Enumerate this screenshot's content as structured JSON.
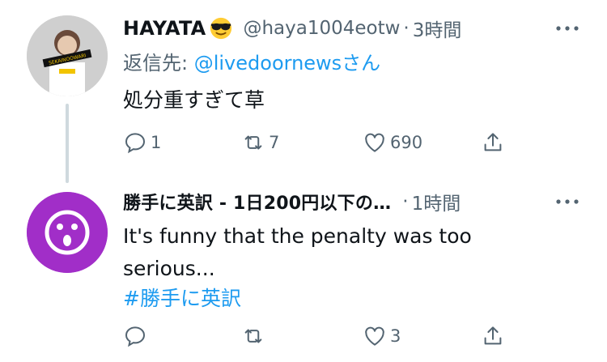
{
  "tweets": [
    {
      "display_name": "HAYATA",
      "handle": "@haya1004eotw",
      "dot": "·",
      "time": "3時間",
      "reply_prefix": "返信先: ",
      "reply_mention": "@livedoornewsさん",
      "text": "処分重すぎて草",
      "avatar_banner": "SEKAINOOWARI",
      "counts": {
        "reply": "1",
        "retweet": "7",
        "like": "690"
      }
    },
    {
      "display_name": "勝手に英訳 - 1日200円以下の…",
      "dot": "·",
      "time": "1時間",
      "text": "It's funny that the penalty was too serious...",
      "hashtag": "#勝手に英訳",
      "counts": {
        "reply": "",
        "retweet": "",
        "like": "3"
      }
    }
  ],
  "colors": {
    "accent": "#1d9bf0",
    "muted": "#536471",
    "avatar_purple": "#a12ec8",
    "thread_line": "#cfd9de"
  },
  "icons": [
    "reply-icon",
    "retweet-icon",
    "like-icon",
    "share-icon",
    "more-icon",
    "sunglasses-emoji"
  ]
}
